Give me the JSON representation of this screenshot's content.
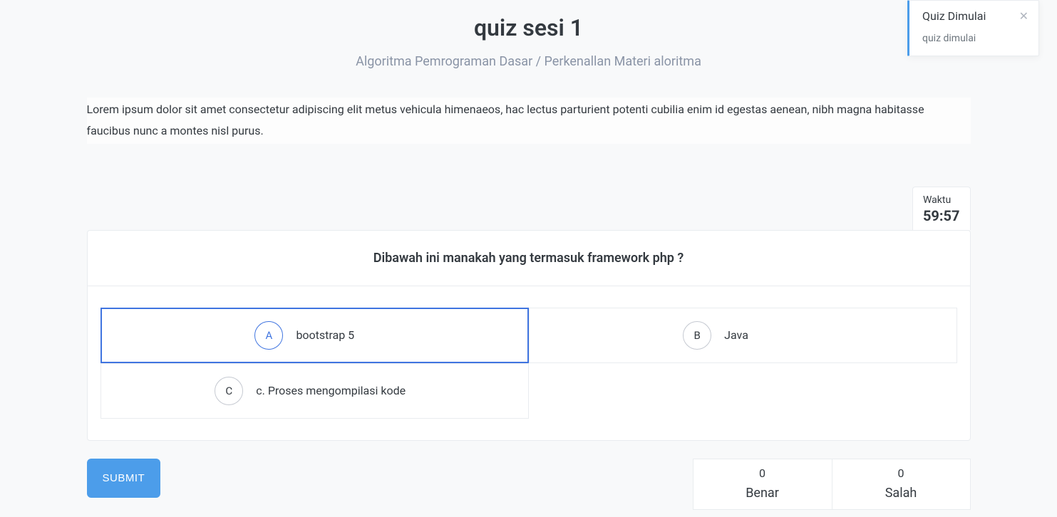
{
  "header": {
    "title": "quiz sesi 1",
    "breadcrumb": "Algoritma Pemrograman Dasar / Perkenallan Materi aloritma"
  },
  "description": "Lorem ipsum dolor sit amet consectetur adipiscing elit metus vehicula himenaeos, hac lectus parturient potenti cubilia enim id egestas aenean, nibh magna habitasse faucibus nunc a montes nisl purus.",
  "timer": {
    "label": "Waktu",
    "value": "59:57"
  },
  "question": {
    "text": "Dibawah ini manakah yang termasuk framework php ?",
    "options": [
      {
        "letter": "A",
        "text": "bootstrap 5",
        "selected": true
      },
      {
        "letter": "B",
        "text": "Java",
        "selected": false
      },
      {
        "letter": "C",
        "text": "c. Proses mengompilasi kode",
        "selected": false
      }
    ]
  },
  "actions": {
    "submit": "SUBMIT"
  },
  "scores": {
    "correct": {
      "count": "0",
      "label": "Benar"
    },
    "wrong": {
      "count": "0",
      "label": "Salah"
    }
  },
  "toast": {
    "title": "Quiz Dimulai",
    "body": "quiz dimulai"
  }
}
